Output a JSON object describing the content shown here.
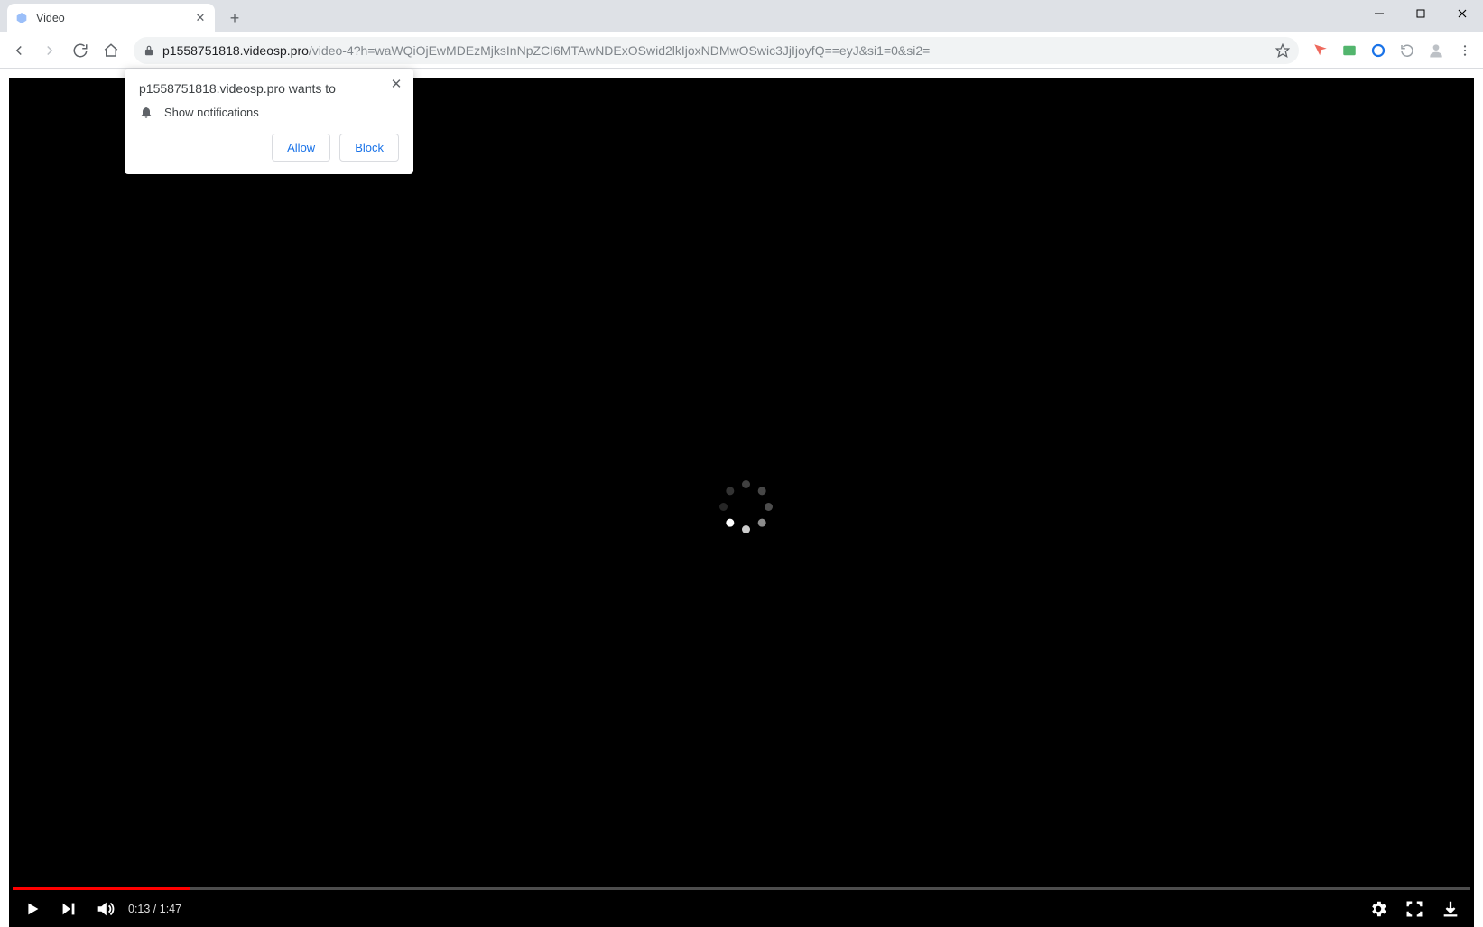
{
  "tab": {
    "title": "Video"
  },
  "url": {
    "host": "p1558751818.videosp.pro",
    "path": "/video-4?h=waWQiOjEwMDEzMjksInNpZCI6MTAwNDExOSwid2lkIjoxNDMwOSwic3JjIjoyfQ==eyJ&si1=0&si2="
  },
  "permission_prompt": {
    "origin_text": "p1558751818.videosp.pro wants to",
    "item_label": "Show notifications",
    "allow_label": "Allow",
    "block_label": "Block"
  },
  "player": {
    "current_time": "0:13",
    "duration": "1:47",
    "time_display": "0:13 / 1:47",
    "progress_percent": 12.15
  },
  "colors": {
    "progress": "#ff0000",
    "link": "#1a73e8"
  }
}
